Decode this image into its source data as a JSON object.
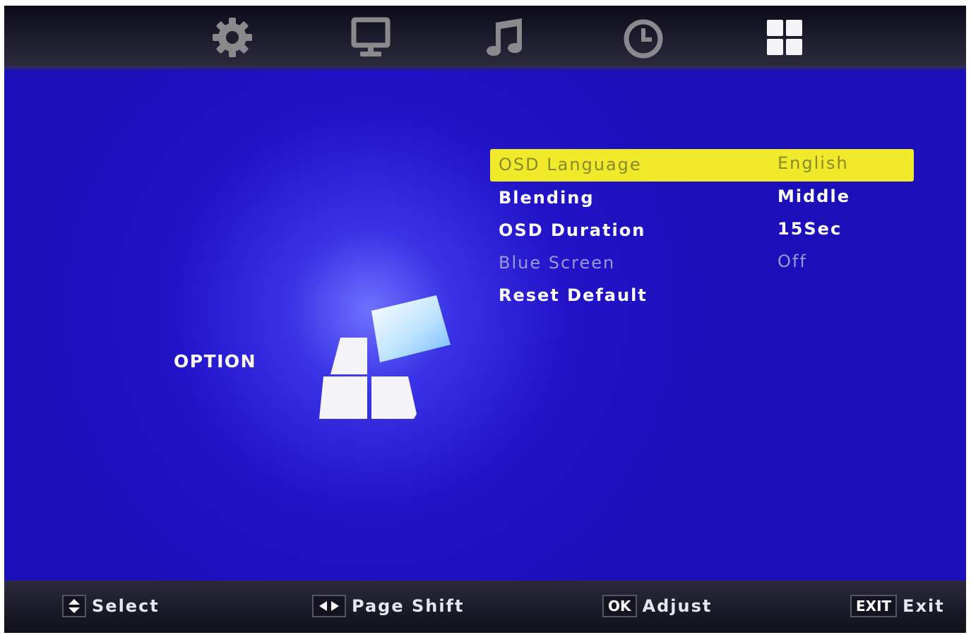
{
  "tabs": [
    {
      "name": "settings",
      "icon": "gear-icon",
      "active": false
    },
    {
      "name": "picture",
      "icon": "monitor-icon",
      "active": false
    },
    {
      "name": "sound",
      "icon": "music-note-icon",
      "active": false
    },
    {
      "name": "time",
      "icon": "clock-icon",
      "active": false
    },
    {
      "name": "option",
      "icon": "grid-icon",
      "active": true
    }
  ],
  "page": {
    "title": "OPTION",
    "icon": "option-blocks-icon"
  },
  "menu": [
    {
      "label": "OSD Language",
      "value": "English",
      "state": "selected"
    },
    {
      "label": "Blending",
      "value": "Middle",
      "state": "normal"
    },
    {
      "label": "OSD Duration",
      "value": "15Sec",
      "state": "normal"
    },
    {
      "label": "Blue Screen",
      "value": "Off",
      "state": "disabled"
    },
    {
      "label": "Reset Default",
      "value": "",
      "state": "normal"
    }
  ],
  "hints": [
    {
      "key": "",
      "key_icon": "up-down-arrows-icon",
      "text": "Select"
    },
    {
      "key": "",
      "key_icon": "left-right-arrows-icon",
      "text": "Page Shift"
    },
    {
      "key": "OK",
      "text": "Adjust"
    },
    {
      "key": "EXIT",
      "text": "Exit"
    }
  ],
  "colors": {
    "background": "#1a0fb8",
    "highlight": "#f0ea2a",
    "highlight_text": "#8a8a2a",
    "disabled_text": "#9a9ad8"
  }
}
